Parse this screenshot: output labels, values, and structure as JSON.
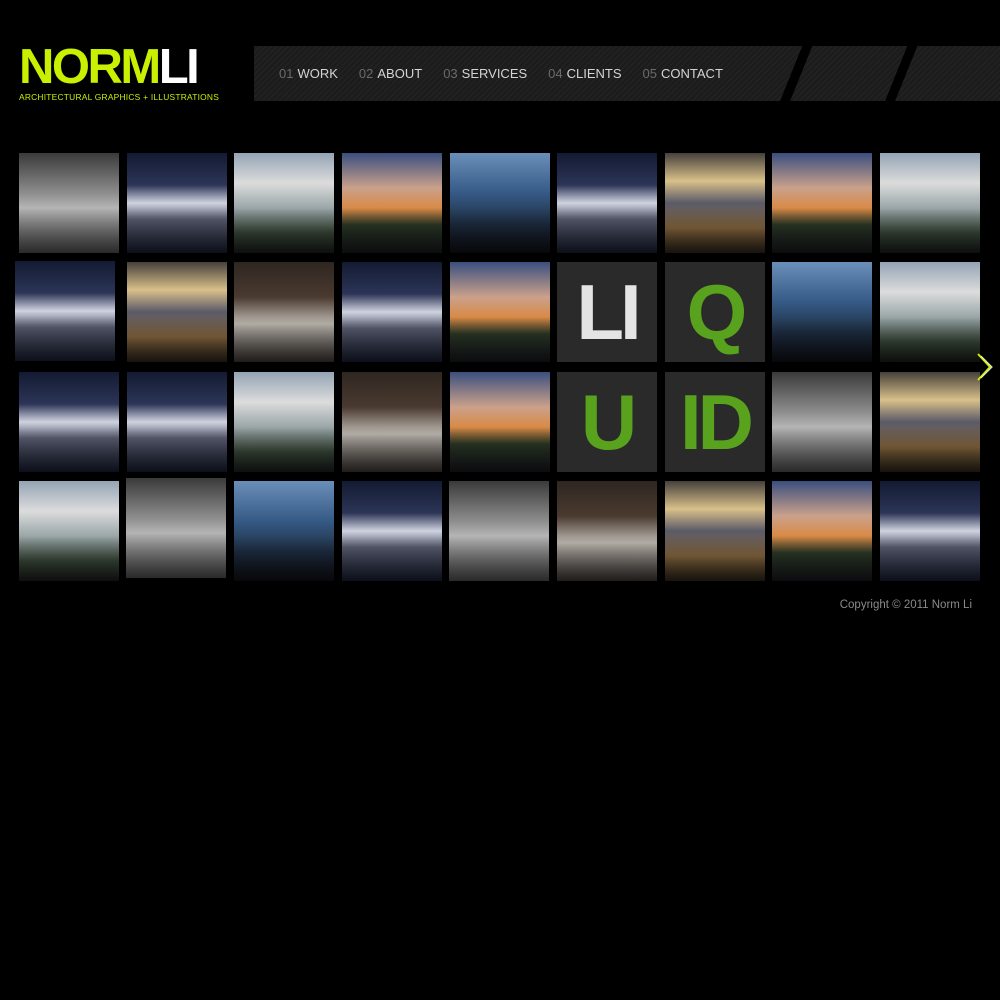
{
  "logo": {
    "norm": "NORM",
    "li": "LI",
    "tagline": "ARCHITECTURAL GRAPHICS + ILLUSTRATIONS"
  },
  "nav": {
    "items": [
      {
        "num": "01",
        "label": "WORK"
      },
      {
        "num": "02",
        "label": "ABOUT"
      },
      {
        "num": "03",
        "label": "SERVICES"
      },
      {
        "num": "04",
        "label": "CLIENTS"
      },
      {
        "num": "05",
        "label": "CONTACT"
      }
    ]
  },
  "gallery": {
    "letters": [
      "LI",
      "Q",
      "U",
      "ID"
    ],
    "letter_colors": {
      "white": "#e4e4e4",
      "green": "#58a21e"
    },
    "next_icon": "chevron-right-icon",
    "accent": "#c8f000"
  },
  "footer": {
    "copyright": "Copyright © 2011 Norm Li"
  }
}
